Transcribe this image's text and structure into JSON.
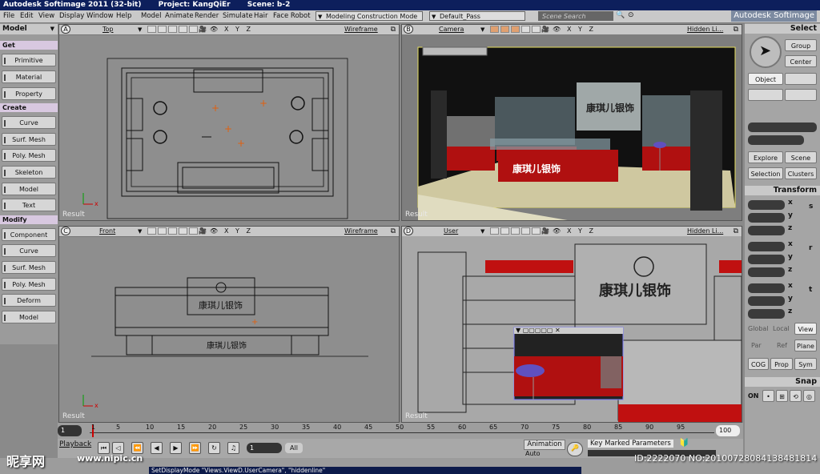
{
  "titlebar": {
    "app": "Autodesk Softimage 2011 (32-bit)",
    "project": "Project: KangQiEr",
    "scene": "Scene: b-2"
  },
  "menubar": {
    "items": [
      "File",
      "Edit",
      "View",
      "Display",
      "Window",
      "Help",
      "Model",
      "Animate",
      "Render",
      "Simulate",
      "Hair",
      "Face Robot"
    ],
    "construction_mode": "Modeling Construction Mode",
    "pass": "Default_Pass",
    "search_placeholder": "Scene Search",
    "brand": "Autodesk Softimage"
  },
  "left_panel": {
    "mode": "Model",
    "get_label": "Get",
    "get_buttons": [
      "Primitive",
      "Material",
      "Property"
    ],
    "create_label": "Create",
    "create_buttons": [
      "Curve",
      "Surf. Mesh",
      "Poly. Mesh",
      "Skeleton",
      "Model",
      "Text"
    ],
    "modify_label": "Modify",
    "modify_buttons": [
      "Component",
      "Curve",
      "Surf. Mesh",
      "Poly. Mesh",
      "Deform",
      "Model"
    ]
  },
  "viewports": {
    "a": {
      "letter": "A",
      "camera": "Top",
      "mode": "Wireframe",
      "result": "Result",
      "axes": "X Y Z"
    },
    "b": {
      "letter": "B",
      "camera": "Camera",
      "mode": "Hidden Li...",
      "result": "Result",
      "axes": "X Y Z",
      "sign_text": "康琪儿银饰"
    },
    "c": {
      "letter": "C",
      "camera": "Front",
      "mode": "Wireframe",
      "result": "Result",
      "axes": "X Y Z",
      "sign_text": "康琪儿银饰"
    },
    "d": {
      "letter": "D",
      "camera": "User",
      "mode": "Hidden Li...",
      "result": "Result",
      "axes": "X Y Z",
      "sign_text": "康琪儿银饰"
    }
  },
  "right_panel": {
    "select_title": "Select",
    "select_buttons": [
      "Group",
      "Center",
      "Object"
    ],
    "explore_buttons": [
      "Explore",
      "Scene",
      "Selection",
      "Clusters"
    ],
    "transform_title": "Transform",
    "axis_labels": [
      "x",
      "y",
      "z"
    ],
    "transform_icons": [
      "s",
      "r",
      "t"
    ],
    "space_labels": [
      "Global",
      "Local",
      "View"
    ],
    "ref_labels": [
      "Par",
      "Ref",
      "Plane"
    ],
    "cog_labels": [
      "COG",
      "Prop",
      "Sym"
    ],
    "snap_title": "Snap",
    "snap_on": "ON"
  },
  "timeline": {
    "ticks": [
      "1",
      "5",
      "10",
      "15",
      "20",
      "25",
      "30",
      "35",
      "40",
      "45",
      "50",
      "55",
      "60",
      "65",
      "70",
      "75",
      "80",
      "85",
      "90",
      "95"
    ],
    "start": "1",
    "end": "100"
  },
  "playback": {
    "label": "Playback",
    "frame_value": "1",
    "all_label": "All",
    "animation_label": "Animation",
    "auto_label": "Auto",
    "key_params_label": "Key Marked Parameters"
  },
  "status": {
    "command": "SetDisplayMode \"Views.ViewD.UserCamera\", \"hiddenline\""
  },
  "watermark": {
    "site": "昵享网",
    "url": "www.nipic.cn",
    "id": "ID:2222070 NO:20100728084138481814"
  },
  "colors": {
    "titlebar": "#0d1f5c",
    "booth_red": "#c01010",
    "booth_dark": "#2a2a2a",
    "selection_yellow": "#e8e060"
  }
}
